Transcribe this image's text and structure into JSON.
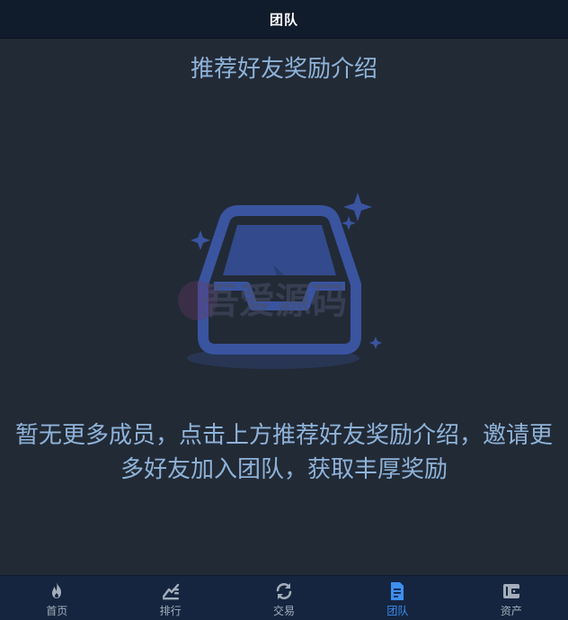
{
  "header": {
    "title": "团队"
  },
  "intro_link": "推荐好友奖励介绍",
  "empty_state": {
    "icon": "empty-inbox-icon",
    "watermark": "吾爱源码",
    "message": "暂无更多成员，点击上方推荐好友奖励介绍，邀请更多好友加入团队，获取丰厚奖励"
  },
  "bottom_nav": {
    "active_index": 3,
    "active_color": "#3d8ff0",
    "items": [
      {
        "label": "首页",
        "icon": "flame-icon"
      },
      {
        "label": "排行",
        "icon": "ranking-icon"
      },
      {
        "label": "交易",
        "icon": "refresh-icon"
      },
      {
        "label": "团队",
        "icon": "document-icon"
      },
      {
        "label": "资产",
        "icon": "wallet-icon"
      }
    ]
  }
}
